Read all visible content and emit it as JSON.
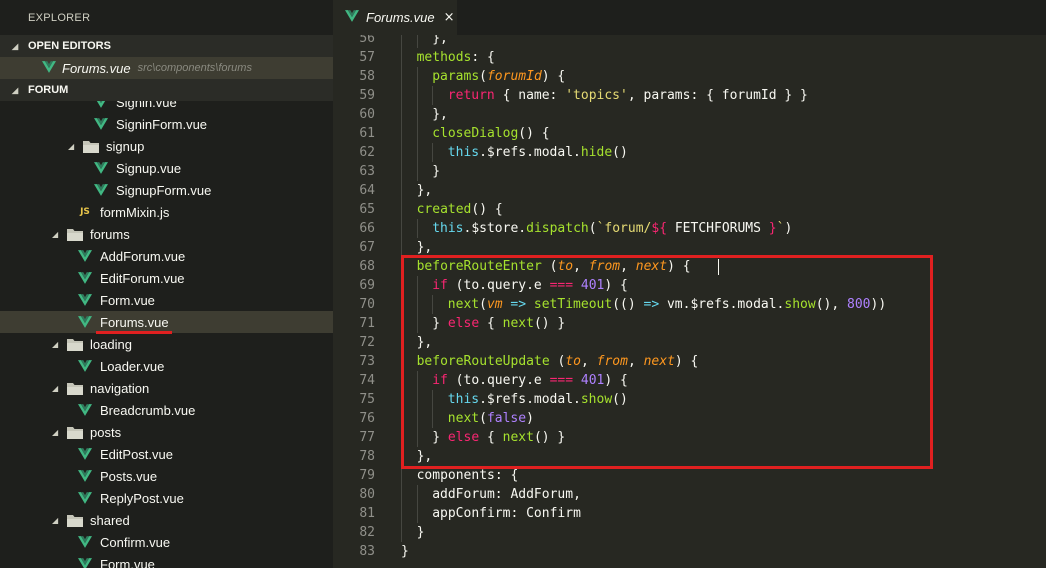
{
  "sidebar": {
    "title": "EXPLORER",
    "open_editors_label": "OPEN EDITORS",
    "open_editor": {
      "name": "Forums.vue",
      "path": "src\\components\\forums"
    },
    "folder_label": "FORUM",
    "tree": [
      {
        "label": "Signin.vue",
        "type": "vue",
        "depth": 2
      },
      {
        "label": "SigninForm.vue",
        "type": "vue",
        "depth": 2
      },
      {
        "label": "signup",
        "type": "folder",
        "depth": 1
      },
      {
        "label": "Signup.vue",
        "type": "vue",
        "depth": 2
      },
      {
        "label": "SignupForm.vue",
        "type": "vue",
        "depth": 2
      },
      {
        "label": "formMixin.js",
        "type": "js",
        "depth": 1
      },
      {
        "label": "forums",
        "type": "folder",
        "depth": 0
      },
      {
        "label": "AddForum.vue",
        "type": "vue",
        "depth": 1
      },
      {
        "label": "EditForum.vue",
        "type": "vue",
        "depth": 1
      },
      {
        "label": "Form.vue",
        "type": "vue",
        "depth": 1
      },
      {
        "label": "Forums.vue",
        "type": "vue",
        "depth": 1,
        "selected": true
      },
      {
        "label": "loading",
        "type": "folder",
        "depth": 0
      },
      {
        "label": "Loader.vue",
        "type": "vue",
        "depth": 1
      },
      {
        "label": "navigation",
        "type": "folder",
        "depth": 0
      },
      {
        "label": "Breadcrumb.vue",
        "type": "vue",
        "depth": 1
      },
      {
        "label": "posts",
        "type": "folder",
        "depth": 0
      },
      {
        "label": "EditPost.vue",
        "type": "vue",
        "depth": 1
      },
      {
        "label": "Posts.vue",
        "type": "vue",
        "depth": 1
      },
      {
        "label": "ReplyPost.vue",
        "type": "vue",
        "depth": 1
      },
      {
        "label": "shared",
        "type": "folder",
        "depth": 0
      },
      {
        "label": "Confirm.vue",
        "type": "vue",
        "depth": 1
      },
      {
        "label": "Form.vue",
        "type": "vue",
        "depth": 1
      }
    ]
  },
  "tabs": [
    {
      "label": "Forums.vue",
      "close_glyph": "×"
    }
  ],
  "colors": {
    "vue_green": "#41b883",
    "highlight_red": "#e02020",
    "keyword": "#f92672",
    "function": "#a6e22e",
    "param": "#fd971f",
    "string": "#e6db74",
    "number": "#ae81ff",
    "type": "#66d9ef"
  },
  "icons": {
    "vue": "vue-icon",
    "js": "js-icon",
    "folder": "folder-icon",
    "close": "close-icon"
  },
  "editor": {
    "lines": [
      {
        "n": "56",
        "indent": 2,
        "tokens": [
          [
            "w",
            "},"
          ]
        ]
      },
      {
        "n": "57",
        "indent": 1,
        "tokens": [
          [
            "f",
            "methods"
          ],
          [
            "w",
            ": {"
          ]
        ]
      },
      {
        "n": "58",
        "indent": 2,
        "tokens": [
          [
            "f",
            "params"
          ],
          [
            "w",
            "("
          ],
          [
            "p",
            "forumId"
          ],
          [
            "w",
            ") {"
          ]
        ]
      },
      {
        "n": "59",
        "indent": 3,
        "tokens": [
          [
            "k",
            "return"
          ],
          [
            "w",
            " { name: "
          ],
          [
            "s",
            "'topics'"
          ],
          [
            "w",
            ", params: { forumId } }"
          ]
        ]
      },
      {
        "n": "60",
        "indent": 2,
        "tokens": [
          [
            "w",
            "},"
          ]
        ]
      },
      {
        "n": "61",
        "indent": 2,
        "tokens": [
          [
            "f",
            "closeDialog"
          ],
          [
            "w",
            "() {"
          ]
        ]
      },
      {
        "n": "62",
        "indent": 3,
        "tokens": [
          [
            "t",
            "this"
          ],
          [
            "w",
            ".$refs.modal."
          ],
          [
            "f",
            "hide"
          ],
          [
            "w",
            "()"
          ]
        ]
      },
      {
        "n": "63",
        "indent": 2,
        "tokens": [
          [
            "w",
            "}"
          ]
        ]
      },
      {
        "n": "64",
        "indent": 1,
        "tokens": [
          [
            "w",
            "},"
          ]
        ]
      },
      {
        "n": "65",
        "indent": 1,
        "tokens": [
          [
            "f",
            "created"
          ],
          [
            "w",
            "() {"
          ]
        ]
      },
      {
        "n": "66",
        "indent": 2,
        "tokens": [
          [
            "t",
            "this"
          ],
          [
            "w",
            ".$store."
          ],
          [
            "f",
            "dispatch"
          ],
          [
            "w",
            "("
          ],
          [
            "s",
            "`forum/"
          ],
          [
            "k",
            "${"
          ],
          [
            "w",
            " FETCHFORUMS "
          ],
          [
            "k",
            "}"
          ],
          [
            "s",
            "`"
          ],
          [
            "w",
            ")"
          ]
        ]
      },
      {
        "n": "67",
        "indent": 1,
        "tokens": [
          [
            "w",
            "},"
          ]
        ]
      },
      {
        "n": "68",
        "indent": 1,
        "tokens": [
          [
            "f",
            "beforeRouteEnter"
          ],
          [
            "w",
            " ("
          ],
          [
            "p",
            "to"
          ],
          [
            "w",
            ", "
          ],
          [
            "p",
            "from"
          ],
          [
            "w",
            ", "
          ],
          [
            "p",
            "next"
          ],
          [
            "w",
            ") {"
          ]
        ]
      },
      {
        "n": "69",
        "indent": 2,
        "tokens": [
          [
            "k",
            "if"
          ],
          [
            "w",
            " (to.query.e "
          ],
          [
            "k",
            "==="
          ],
          [
            "w",
            " "
          ],
          [
            "n",
            "401"
          ],
          [
            "w",
            ") {"
          ]
        ]
      },
      {
        "n": "70",
        "indent": 3,
        "tokens": [
          [
            "f",
            "next"
          ],
          [
            "w",
            "("
          ],
          [
            "p",
            "vm"
          ],
          [
            "w",
            " "
          ],
          [
            "t",
            "=>"
          ],
          [
            "w",
            " "
          ],
          [
            "f",
            "setTimeout"
          ],
          [
            "w",
            "(() "
          ],
          [
            "t",
            "=>"
          ],
          [
            "w",
            " vm.$refs.modal."
          ],
          [
            "f",
            "show"
          ],
          [
            "w",
            "(), "
          ],
          [
            "n",
            "800"
          ],
          [
            "w",
            "))"
          ]
        ]
      },
      {
        "n": "71",
        "indent": 2,
        "tokens": [
          [
            "w",
            "} "
          ],
          [
            "k",
            "else"
          ],
          [
            "w",
            " { "
          ],
          [
            "f",
            "next"
          ],
          [
            "w",
            "() }"
          ]
        ]
      },
      {
        "n": "72",
        "indent": 1,
        "tokens": [
          [
            "w",
            "},"
          ]
        ]
      },
      {
        "n": "73",
        "indent": 1,
        "tokens": [
          [
            "f",
            "beforeRouteUpdate"
          ],
          [
            "w",
            " ("
          ],
          [
            "p",
            "to"
          ],
          [
            "w",
            ", "
          ],
          [
            "p",
            "from"
          ],
          [
            "w",
            ", "
          ],
          [
            "p",
            "next"
          ],
          [
            "w",
            ") {"
          ]
        ]
      },
      {
        "n": "74",
        "indent": 2,
        "tokens": [
          [
            "k",
            "if"
          ],
          [
            "w",
            " (to.query.e "
          ],
          [
            "k",
            "==="
          ],
          [
            "w",
            " "
          ],
          [
            "n",
            "401"
          ],
          [
            "w",
            ") {"
          ]
        ]
      },
      {
        "n": "75",
        "indent": 3,
        "tokens": [
          [
            "t",
            "this"
          ],
          [
            "w",
            ".$refs.modal."
          ],
          [
            "f",
            "show"
          ],
          [
            "w",
            "()"
          ]
        ]
      },
      {
        "n": "76",
        "indent": 3,
        "tokens": [
          [
            "f",
            "next"
          ],
          [
            "w",
            "("
          ],
          [
            "n",
            "false"
          ],
          [
            "w",
            ")"
          ]
        ]
      },
      {
        "n": "77",
        "indent": 2,
        "tokens": [
          [
            "w",
            "} "
          ],
          [
            "k",
            "else"
          ],
          [
            "w",
            " { "
          ],
          [
            "f",
            "next"
          ],
          [
            "w",
            "() }"
          ]
        ]
      },
      {
        "n": "78",
        "indent": 1,
        "tokens": [
          [
            "w",
            "},"
          ]
        ]
      },
      {
        "n": "79",
        "indent": 1,
        "tokens": [
          [
            "w",
            "components: {"
          ]
        ]
      },
      {
        "n": "80",
        "indent": 2,
        "tokens": [
          [
            "w",
            "addForum: AddForum,"
          ]
        ]
      },
      {
        "n": "81",
        "indent": 2,
        "tokens": [
          [
            "w",
            "appConfirm: Confirm"
          ]
        ]
      },
      {
        "n": "82",
        "indent": 1,
        "tokens": [
          [
            "w",
            "}"
          ]
        ]
      },
      {
        "n": "83",
        "indent": 0,
        "tokens": [
          [
            "w",
            "}"
          ]
        ]
      }
    ]
  }
}
